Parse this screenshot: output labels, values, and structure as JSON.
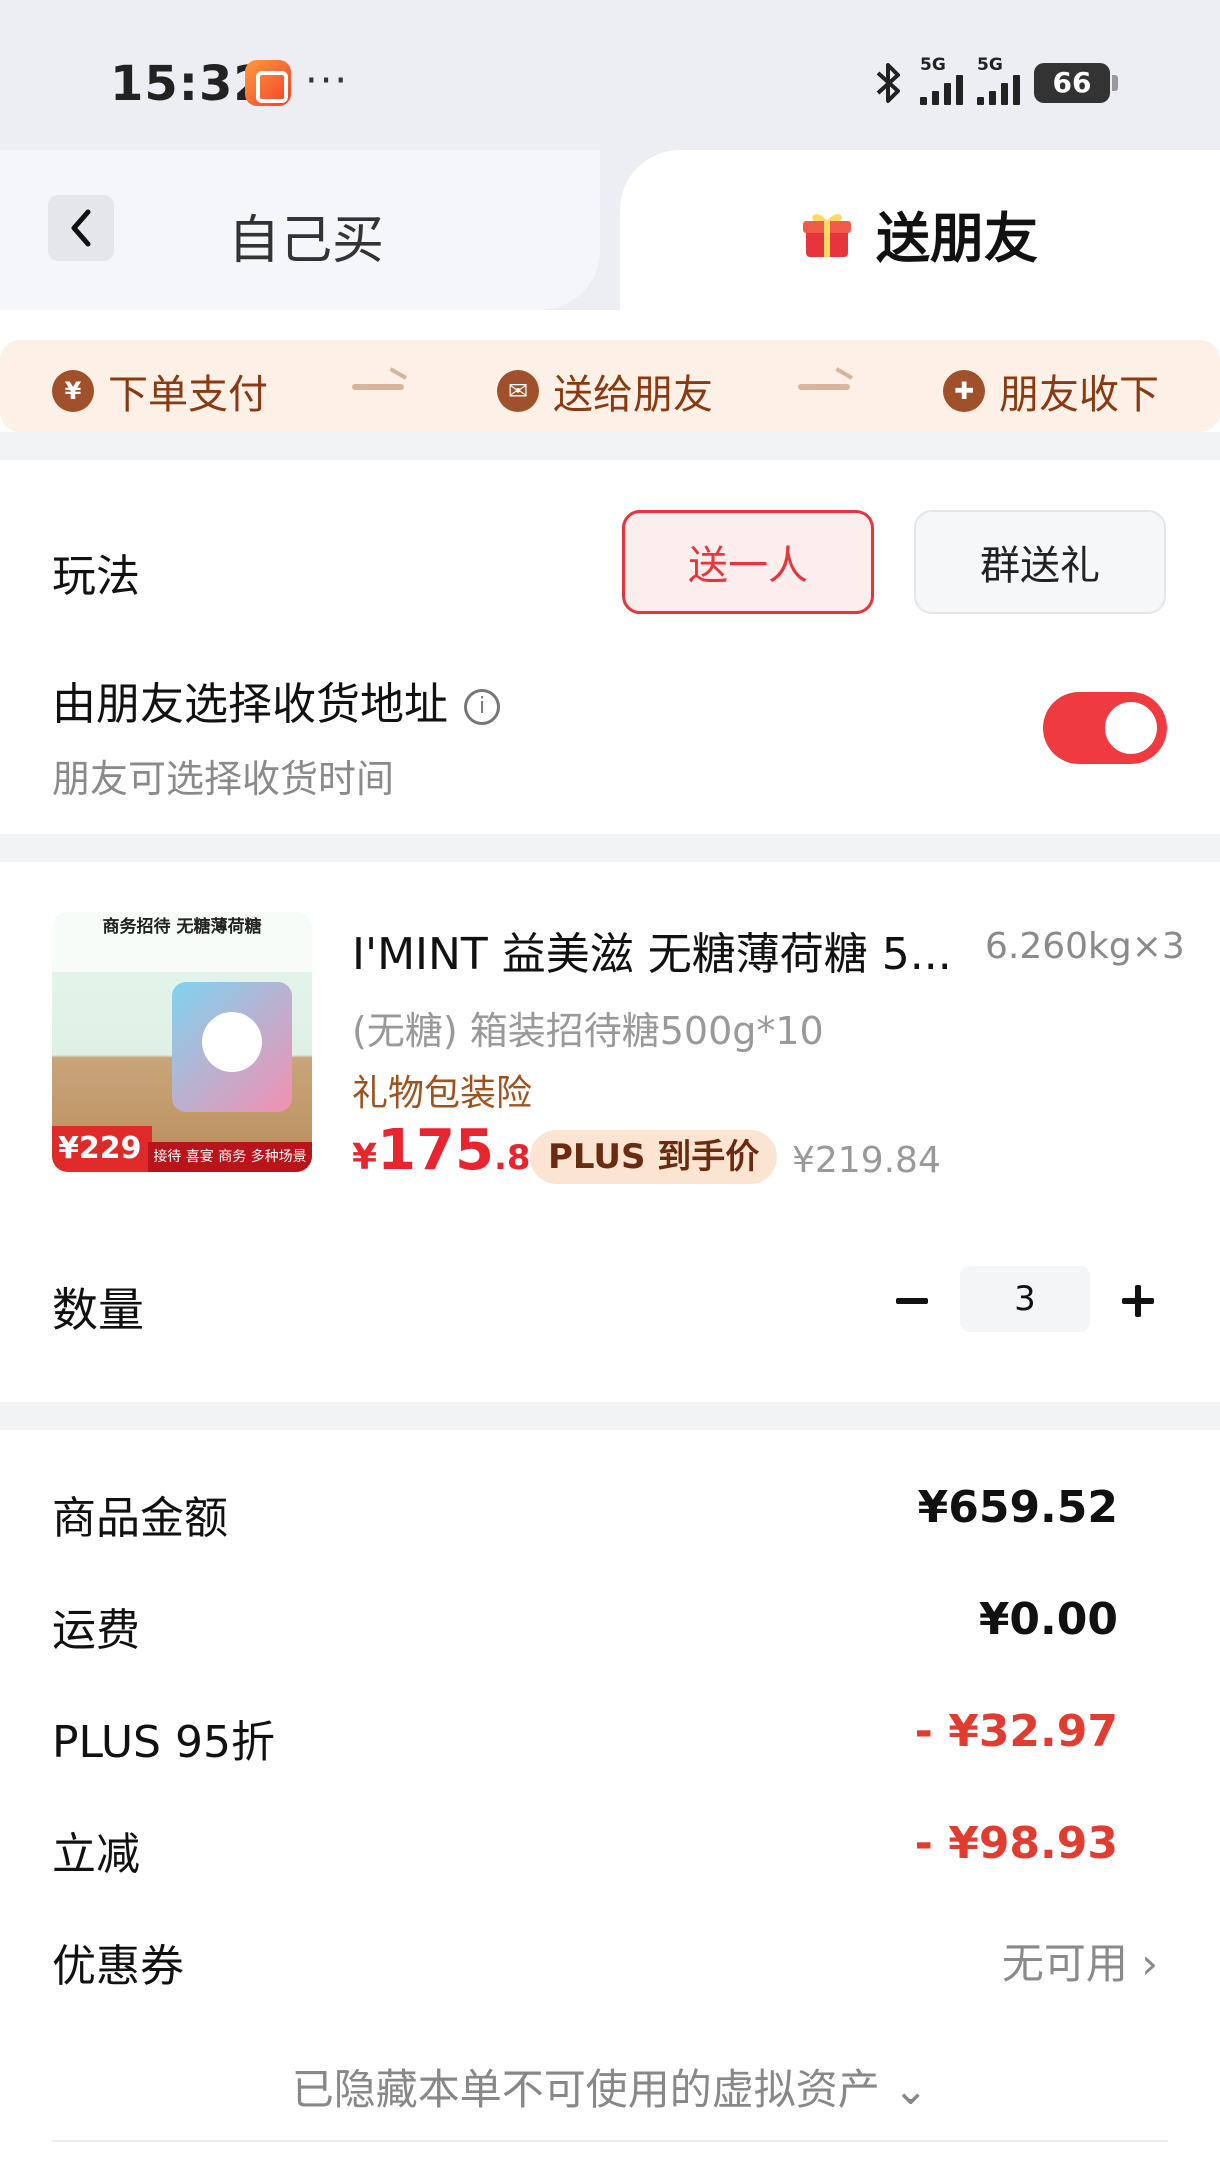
{
  "status_bar": {
    "time": "15:32",
    "dots": "···",
    "signal1_label": "5G",
    "signal2_label": "5G",
    "battery": "66"
  },
  "tabs": {
    "self_label": "自己买",
    "friend_label": "送朋友"
  },
  "steps": [
    {
      "icon": "yen-icon",
      "icon_glyph": "¥",
      "label": "下单支付"
    },
    {
      "icon": "wechat-icon",
      "icon_glyph": "✉",
      "label": "送给朋友"
    },
    {
      "icon": "gift-icon",
      "icon_glyph": "✚",
      "label": "朋友收下"
    }
  ],
  "play": {
    "label": "玩法",
    "options": [
      "送一人",
      "群送礼"
    ],
    "selected": "送一人"
  },
  "address": {
    "title": "由朋友选择收货地址",
    "subtitle": "朋友可选择收货时间",
    "toggle_on": true
  },
  "product": {
    "image_top_text": "商务招待 无糖薄荷糖",
    "image_price": "¥229",
    "image_band": "接待 喜宴 商务 多种场景",
    "title": "I'MINT 益美滋 无糖薄荷糖 5...",
    "weight": "6.260kg×3",
    "spec": "(无糖) 箱装招待糖500g*10",
    "insurance": "礼物包装险",
    "price_symbol": "¥",
    "price_int": "175",
    "price_dec": ".87",
    "plus_badge": "PLUS 到手价",
    "original_price": "¥219.84"
  },
  "quantity": {
    "label": "数量",
    "value": "3"
  },
  "summary": [
    {
      "label": "商品金额",
      "value": "¥659.52",
      "style": "bold"
    },
    {
      "label": "运费",
      "value": "¥0.00",
      "style": "bold"
    },
    {
      "label": "PLUS 95折",
      "value": "- ¥32.97",
      "style": "red"
    },
    {
      "label": "立减",
      "value": "- ¥98.93",
      "style": "red"
    }
  ],
  "coupon": {
    "label": "优惠券",
    "value": "无可用 ›"
  },
  "hidden_note": "已隐藏本单不可使用的虚拟资产 ⌄",
  "colors": {
    "accent_red": "#e8343d",
    "step_brown": "#a0502a",
    "header_bg": "#eceef3"
  }
}
